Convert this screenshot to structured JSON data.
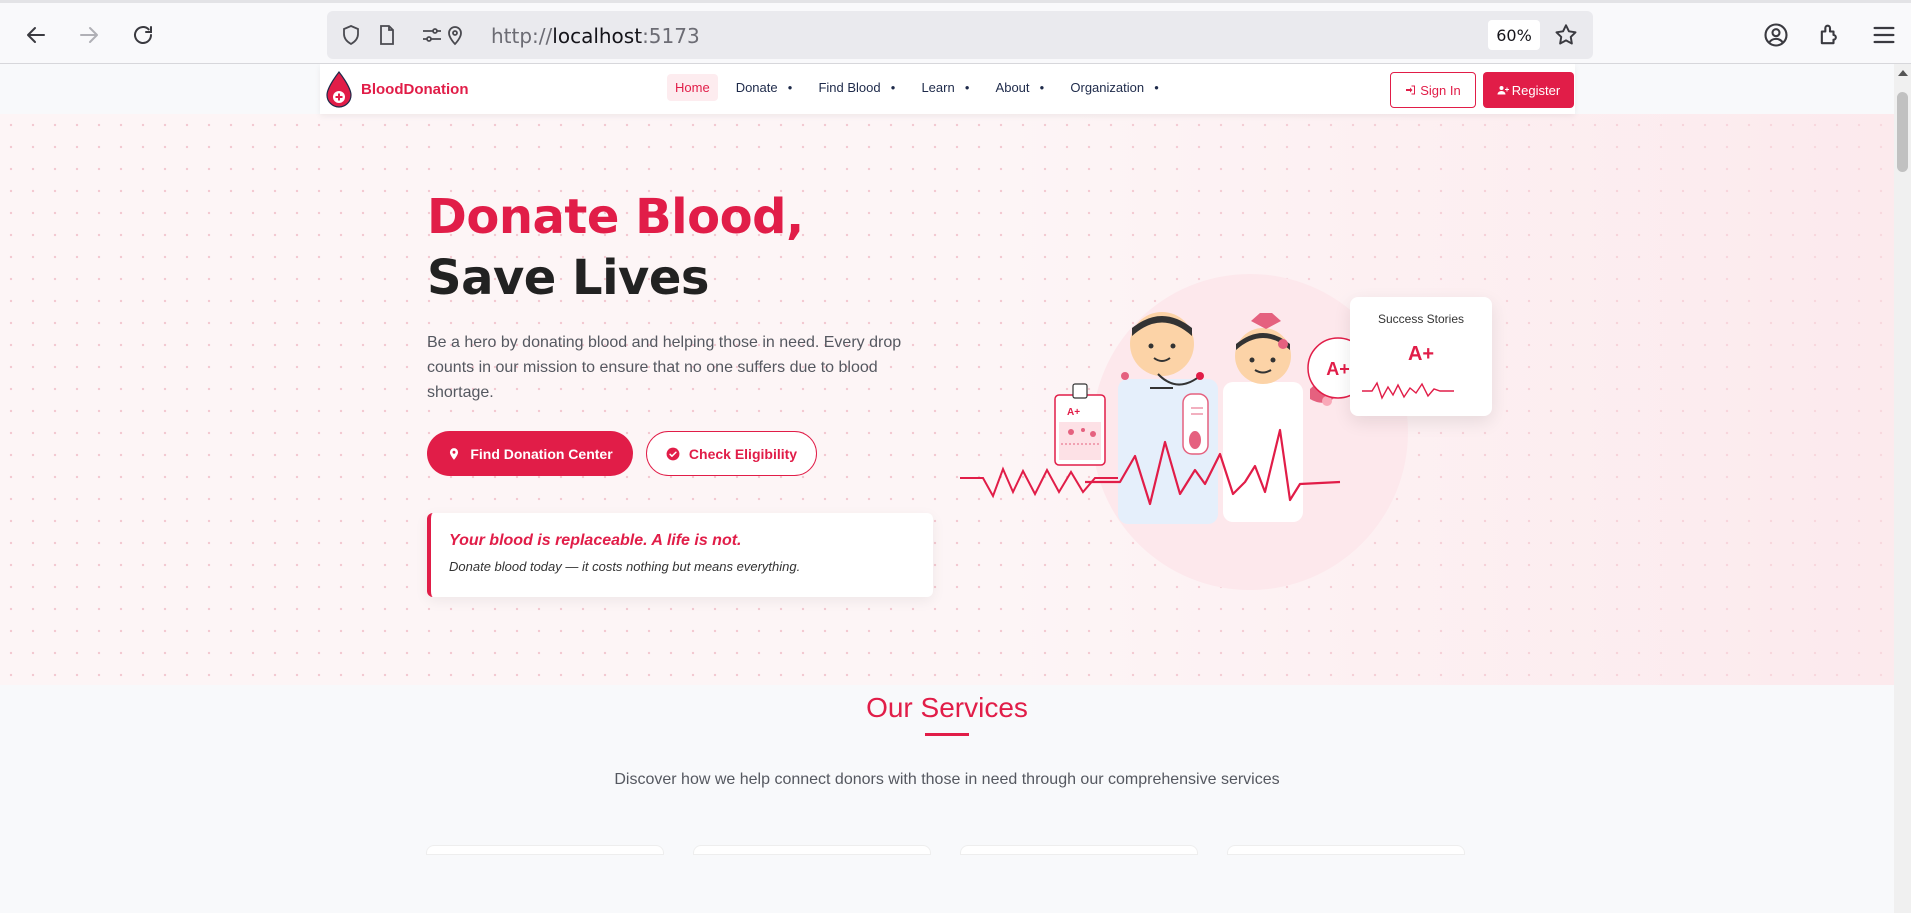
{
  "browser": {
    "url_prefix": "http://",
    "url_host": "localhost",
    "url_port": ":5173",
    "zoom": "60%"
  },
  "nav": {
    "brand": "BloodDonation",
    "items": [
      {
        "label": "Home",
        "active": true
      },
      {
        "label": "Donate",
        "dropdown": true
      },
      {
        "label": "Find Blood",
        "dropdown": true
      },
      {
        "label": "Learn",
        "dropdown": true
      },
      {
        "label": "About",
        "dropdown": true
      },
      {
        "label": "Organization",
        "dropdown": true
      }
    ],
    "signin": "Sign In",
    "register": "Register"
  },
  "hero": {
    "title_line1": "Donate Blood,",
    "title_line2": "Save Lives",
    "lead": "Be a hero by donating blood and helping those in need. Every drop counts in our mission to ensure that no one suffers due to blood shortage.",
    "btn_find": "Find Donation Center",
    "btn_eligibility": "Check Eligibility",
    "quote_main": "Your blood is replaceable. A life is not.",
    "quote_sub": "Donate blood today — it costs nothing but means everything.",
    "bag_label": "A+",
    "badge_label": "A+",
    "stories_title": "Success Stories",
    "stories_type": "A+"
  },
  "services": {
    "title": "Our Services",
    "subtitle": "Discover how we help connect donors with those in need through our comprehensive services"
  },
  "colors": {
    "brand": "#e11d48",
    "text_dark": "#222222",
    "text_muted": "#555860"
  }
}
